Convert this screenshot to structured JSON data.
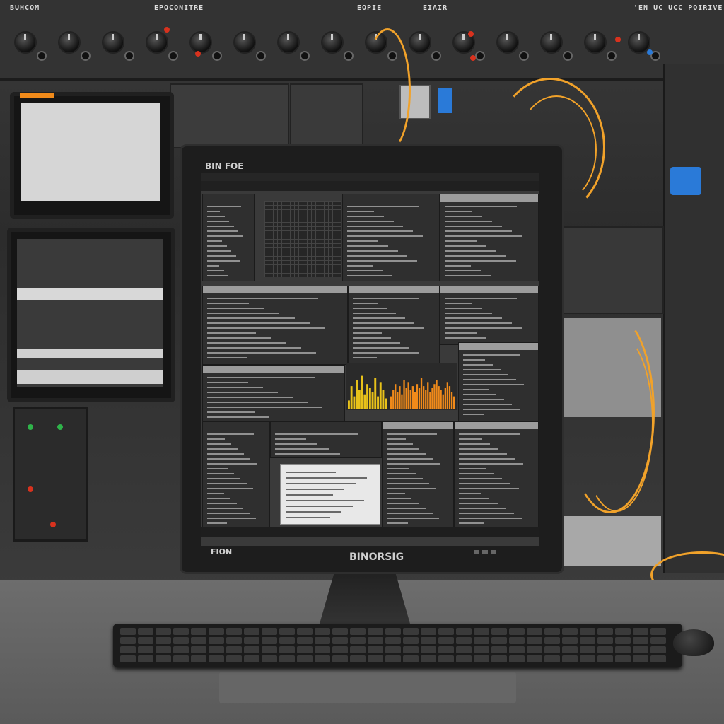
{
  "rack": {
    "label_left": "BUHCOM",
    "label_center": "EPOCONITRE",
    "label_center2": "EOPIE",
    "label_center3": "EIAIR",
    "label_right": "'EN UC UCC POIRIVE"
  },
  "monitor": {
    "top_left_text": "BIN FOE",
    "bottom_left_text": "FION",
    "brand": "BINORSIG"
  },
  "colors": {
    "accent_orange": "#f1a22a",
    "bar_yellow": "#e8c21a",
    "bar_orange": "#f08a1a",
    "led_red": "#d8321e",
    "led_green": "#2fb34a",
    "led_blue": "#2a7ad8"
  },
  "chart_data": {
    "type": "bar",
    "series": [
      {
        "values": [
          20,
          55,
          30,
          70,
          45,
          80,
          35,
          60,
          50,
          40,
          75,
          30,
          65,
          45,
          25
        ]
      },
      {
        "values": [
          30,
          45,
          60,
          40,
          55,
          35,
          70,
          50,
          65,
          45,
          55,
          40,
          60,
          50,
          75,
          55,
          45,
          65,
          40,
          50,
          60,
          70,
          55,
          45,
          35,
          50,
          65,
          55,
          40,
          30
        ]
      }
    ]
  }
}
